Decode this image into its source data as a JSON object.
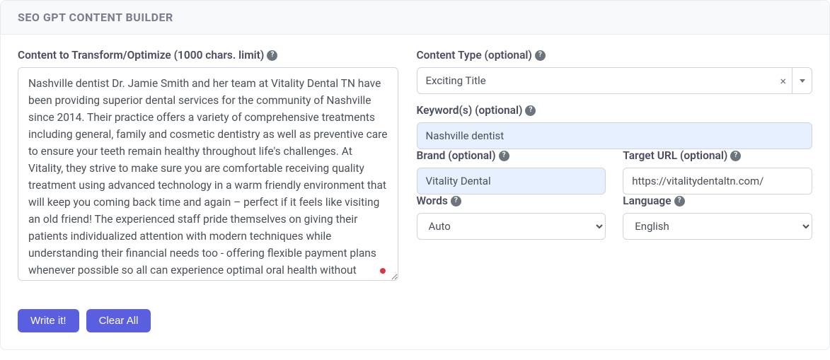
{
  "header": {
    "title": "SEO GPT CONTENT BUILDER"
  },
  "left": {
    "content_label": "Content to Transform/Optimize (1000 chars. limit)",
    "content_value": "Nashville dentist Dr. Jamie Smith and her team at Vitality Dental TN have been providing superior dental services for the community of Nashville since 2014. Their practice offers a variety of comprehensive treatments including general, family and cosmetic dentistry as well as preventive care to ensure your teeth remain healthy throughout life's challenges. At Vitality, they strive to make sure you are comfortable receiving quality treatment using advanced technology in a warm friendly environment that will keep you coming back time and again – perfect if it feels like visiting an old friend! The experienced staff pride themselves on giving their patients individualized attention with modern techniques while understanding their financial needs too - offering flexible payment plans whenever possible so all can experience optimal oral health without"
  },
  "right": {
    "content_type_label": "Content Type (optional)",
    "content_type_value": "Exciting Title",
    "keywords_label": "Keyword(s) (optional)",
    "keywords_value": "Nashville dentist",
    "brand_label": "Brand (optional)",
    "brand_value": "Vitality Dental",
    "target_url_label": "Target URL (optional)",
    "target_url_value": "https://vitalitydentaltn.com/",
    "words_label": "Words",
    "words_value": "Auto",
    "language_label": "Language",
    "language_value": "English"
  },
  "buttons": {
    "write": "Write it!",
    "clear": "Clear All"
  }
}
